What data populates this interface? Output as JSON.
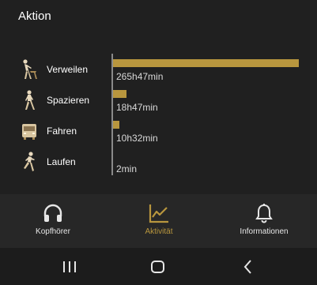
{
  "header": {
    "title": "Aktion"
  },
  "colors": {
    "accent": "#b8963e",
    "background": "#202020"
  },
  "activities": [
    {
      "label": "Verweilen",
      "duration": "265h47min",
      "icon": "standing-person-icon",
      "bar_fraction": 1.0
    },
    {
      "label": "Spazieren",
      "duration": "18h47min",
      "icon": "walking-person-icon",
      "bar_fraction": 0.071
    },
    {
      "label": "Fahren",
      "duration": "10h32min",
      "icon": "bus-icon",
      "bar_fraction": 0.034
    },
    {
      "label": "Laufen",
      "duration": "2min",
      "icon": "running-person-icon",
      "bar_fraction": 0.0
    }
  ],
  "tabs": [
    {
      "label": "Kopfhörer",
      "icon": "headphones-icon",
      "active": false
    },
    {
      "label": "Aktivität",
      "icon": "activity-chart-icon",
      "active": true
    },
    {
      "label": "Informationen",
      "icon": "bell-icon",
      "active": false
    }
  ],
  "navbar": {
    "icons": [
      "recent-apps-icon",
      "home-icon",
      "back-icon"
    ]
  }
}
